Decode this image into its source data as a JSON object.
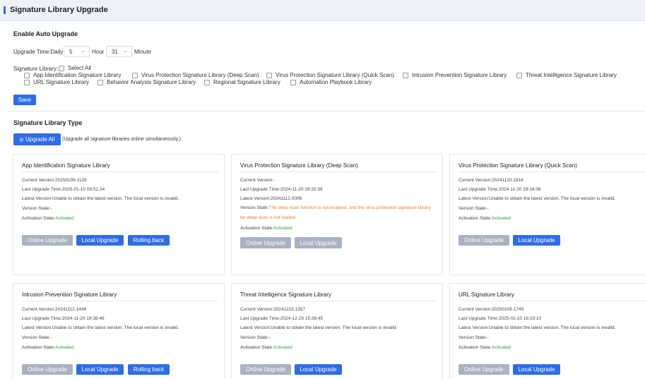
{
  "page": {
    "title": "Signature Library Upgrade"
  },
  "auto_upgrade": {
    "title": "Enable Auto Upgrade",
    "time_label": "Upgrade Time:Daily",
    "hour_value": "5",
    "hour_label": "Hour",
    "minute_value": "31",
    "minute_label": "Minute",
    "library_label": "Signature Library:",
    "select_all": "Select All",
    "libraries": [
      "App Identification Signature Library",
      "Virus Protection Signature Library (Deep Scan)",
      "Virus Protection Signature Library (Quick Scan)",
      "Intrusion Prevention Signature Library",
      "Threat Intelligence Signature Library",
      "URL Signature Library",
      "Behavior Analysis Signature Library",
      "Regional Signature Library",
      "Automation Playbook Library"
    ],
    "save_label": "Save"
  },
  "types": {
    "title": "Signature Library Type",
    "upgrade_all_label": "Upgrade All",
    "upgrade_all_note": "(Upgrade all signature libraries online simultaneously.)"
  },
  "labels": {
    "current_version": "Current Version:",
    "last_upgrade_time": "Last Upgrade Time:",
    "latest_version": "Latest Version:",
    "version_state": "Version State:",
    "activation_state": "Activation State:",
    "online_upgrade": "Online Upgrade",
    "local_upgrade": "Local Upgrade",
    "rolling_back": "Rolling back"
  },
  "cards": [
    {
      "title": "App Identification Signature Library",
      "current_version": "20250106.1126",
      "last_upgrade_time": "2025-01-10 09:51:24",
      "latest_version": "Unable to obtain the latest version. The local version is invalid.",
      "version_state": "-",
      "activation_state": "Activated"
    },
    {
      "title": "Virus Protection Signature Library (Deep Scan)",
      "current_version": "-",
      "last_upgrade_time": "2024-11-20 19:32:38",
      "latest_version": "20241112.0006",
      "version_state": "The deep scan function is not enabled, and the virus protection signature library for deep scan is not loaded",
      "activation_state": "Activated"
    },
    {
      "title": "Virus Protection Signature Library (Quick Scan)",
      "current_version": "20241120.1814",
      "last_upgrade_time": "2024-11-20 19:34:38",
      "latest_version": "Unable to obtain the latest version. The local version is invalid.",
      "version_state": "-",
      "activation_state": "Activated"
    },
    {
      "title": "Intrusion Prevention Signature Library",
      "current_version": "20241112.1448",
      "last_upgrade_time": "2024-11-20 19:38:46",
      "latest_version": "Unable to obtain the latest version. The local version is invalid.",
      "version_state": "-",
      "activation_state": "Activated"
    },
    {
      "title": "Threat Intelligence Signature Library",
      "current_version": "20241223.1357",
      "last_upgrade_time": "2024-12-23 15:38:45",
      "latest_version": "Unable to obtain the latest version. The local version is invalid.",
      "version_state": "-",
      "activation_state": "Activated"
    },
    {
      "title": "URL Signature Library",
      "current_version": "20250109.1749",
      "last_upgrade_time": "2025-01-10 16:19:10",
      "latest_version": "Unable to obtain the latest version. The local version is invalid.",
      "version_state": "-",
      "activation_state": "Activated"
    }
  ],
  "colors": {
    "accent": "#2f6de6",
    "disabled": "#a9b3c1",
    "success": "#2e9e3e",
    "warning": "#e67e22"
  }
}
